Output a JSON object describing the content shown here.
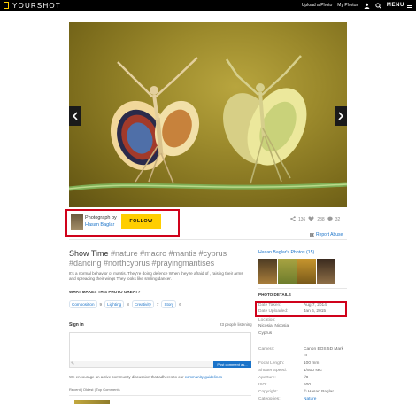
{
  "nav": {
    "brand": "YOURSHOT",
    "links": [
      "Upload a Photo",
      "My Photos"
    ],
    "menu": "MENU"
  },
  "photo": {
    "prev_icon": "chevron-left-icon",
    "next_icon": "chevron-right-icon"
  },
  "credit": {
    "by_label": "Photograph by",
    "name": "Hasan Baglar",
    "follow": "FOLLOW"
  },
  "stats": {
    "shares": "136",
    "likes": "238",
    "comments": "32"
  },
  "report": "Report Abuse",
  "title": "Show Time",
  "tags": "#nature #macro #mantis #cyprus #dancing #northcyprus #prayingmantises",
  "description": "It's a normal behavior of mantis. They're doing defence When they're afraid of , raising their arms and spreading their wings They looks like smiling dancer.",
  "makes_label": "WHAT MAKES THIS PHOTO GREAT?",
  "categories": [
    {
      "label": "Composition",
      "count": "9"
    },
    {
      "label": "Lighting",
      "count": "8"
    },
    {
      "label": "Creativity",
      "count": "7"
    },
    {
      "label": "Story",
      "count": "6"
    }
  ],
  "comments": {
    "sign_in": "Sign in",
    "listening": "23 people listening",
    "post_button": "Post comment as...",
    "guidelines_prefix": "We encourage an active community discussion that adheres to our",
    "guidelines_link": "community guidelines",
    "sort": "Recent | Oldest | Top Comments"
  },
  "sidebar": {
    "photos_heading": "Hasan Baglar's Photos (15)",
    "details_heading": "PHOTO DETAILS",
    "date_taken_label": "Date Taken:",
    "date_taken": "Aug 7, 2014",
    "date_uploaded_label": "Date Uploaded:",
    "date_uploaded": "Jan 6, 2015",
    "location_label": "Location:",
    "location": "Nicosia, Nicosia,",
    "country": "Cyprus",
    "camera_label": "Camera:",
    "camera": "Canon EOS 5D Mark",
    "camera2": "III",
    "focal_label": "Focal Length:",
    "focal": "100 mm",
    "shutter_label": "Shutter Speed:",
    "shutter": "1/500 sec",
    "aperture_label": "Aperture:",
    "aperture": "f/8",
    "iso_label": "ISO:",
    "iso": "500",
    "copyright_label": "Copyright:",
    "copyright": "© Hasan Baglar",
    "categories_label": "Categories:",
    "categories": "Nature"
  },
  "colors": {
    "accent": "#ffce00",
    "link": "#1a73c9",
    "highlight": "#d0021b"
  }
}
